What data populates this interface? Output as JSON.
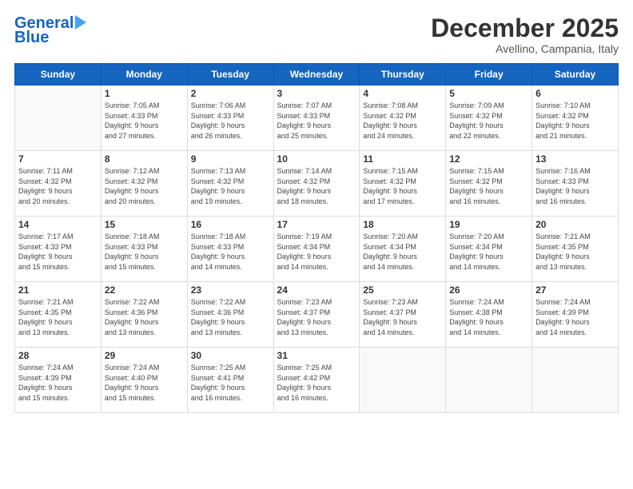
{
  "header": {
    "logo_line1": "General",
    "logo_line2": "Blue",
    "title": "December 2025",
    "subtitle": "Avellino, Campania, Italy"
  },
  "weekdays": [
    "Sunday",
    "Monday",
    "Tuesday",
    "Wednesday",
    "Thursday",
    "Friday",
    "Saturday"
  ],
  "weeks": [
    [
      {
        "num": "",
        "info": ""
      },
      {
        "num": "1",
        "info": "Sunrise: 7:05 AM\nSunset: 4:33 PM\nDaylight: 9 hours\nand 27 minutes."
      },
      {
        "num": "2",
        "info": "Sunrise: 7:06 AM\nSunset: 4:33 PM\nDaylight: 9 hours\nand 26 minutes."
      },
      {
        "num": "3",
        "info": "Sunrise: 7:07 AM\nSunset: 4:33 PM\nDaylight: 9 hours\nand 25 minutes."
      },
      {
        "num": "4",
        "info": "Sunrise: 7:08 AM\nSunset: 4:32 PM\nDaylight: 9 hours\nand 24 minutes."
      },
      {
        "num": "5",
        "info": "Sunrise: 7:09 AM\nSunset: 4:32 PM\nDaylight: 9 hours\nand 22 minutes."
      },
      {
        "num": "6",
        "info": "Sunrise: 7:10 AM\nSunset: 4:32 PM\nDaylight: 9 hours\nand 21 minutes."
      }
    ],
    [
      {
        "num": "7",
        "info": "Sunrise: 7:11 AM\nSunset: 4:32 PM\nDaylight: 9 hours\nand 20 minutes."
      },
      {
        "num": "8",
        "info": "Sunrise: 7:12 AM\nSunset: 4:32 PM\nDaylight: 9 hours\nand 20 minutes."
      },
      {
        "num": "9",
        "info": "Sunrise: 7:13 AM\nSunset: 4:32 PM\nDaylight: 9 hours\nand 19 minutes."
      },
      {
        "num": "10",
        "info": "Sunrise: 7:14 AM\nSunset: 4:32 PM\nDaylight: 9 hours\nand 18 minutes."
      },
      {
        "num": "11",
        "info": "Sunrise: 7:15 AM\nSunset: 4:32 PM\nDaylight: 9 hours\nand 17 minutes."
      },
      {
        "num": "12",
        "info": "Sunrise: 7:15 AM\nSunset: 4:32 PM\nDaylight: 9 hours\nand 16 minutes."
      },
      {
        "num": "13",
        "info": "Sunrise: 7:16 AM\nSunset: 4:33 PM\nDaylight: 9 hours\nand 16 minutes."
      }
    ],
    [
      {
        "num": "14",
        "info": "Sunrise: 7:17 AM\nSunset: 4:33 PM\nDaylight: 9 hours\nand 15 minutes."
      },
      {
        "num": "15",
        "info": "Sunrise: 7:18 AM\nSunset: 4:33 PM\nDaylight: 9 hours\nand 15 minutes."
      },
      {
        "num": "16",
        "info": "Sunrise: 7:18 AM\nSunset: 4:33 PM\nDaylight: 9 hours\nand 14 minutes."
      },
      {
        "num": "17",
        "info": "Sunrise: 7:19 AM\nSunset: 4:34 PM\nDaylight: 9 hours\nand 14 minutes."
      },
      {
        "num": "18",
        "info": "Sunrise: 7:20 AM\nSunset: 4:34 PM\nDaylight: 9 hours\nand 14 minutes."
      },
      {
        "num": "19",
        "info": "Sunrise: 7:20 AM\nSunset: 4:34 PM\nDaylight: 9 hours\nand 14 minutes."
      },
      {
        "num": "20",
        "info": "Sunrise: 7:21 AM\nSunset: 4:35 PM\nDaylight: 9 hours\nand 13 minutes."
      }
    ],
    [
      {
        "num": "21",
        "info": "Sunrise: 7:21 AM\nSunset: 4:35 PM\nDaylight: 9 hours\nand 13 minutes."
      },
      {
        "num": "22",
        "info": "Sunrise: 7:22 AM\nSunset: 4:36 PM\nDaylight: 9 hours\nand 13 minutes."
      },
      {
        "num": "23",
        "info": "Sunrise: 7:22 AM\nSunset: 4:36 PM\nDaylight: 9 hours\nand 13 minutes."
      },
      {
        "num": "24",
        "info": "Sunrise: 7:23 AM\nSunset: 4:37 PM\nDaylight: 9 hours\nand 13 minutes."
      },
      {
        "num": "25",
        "info": "Sunrise: 7:23 AM\nSunset: 4:37 PM\nDaylight: 9 hours\nand 14 minutes."
      },
      {
        "num": "26",
        "info": "Sunrise: 7:24 AM\nSunset: 4:38 PM\nDaylight: 9 hours\nand 14 minutes."
      },
      {
        "num": "27",
        "info": "Sunrise: 7:24 AM\nSunset: 4:39 PM\nDaylight: 9 hours\nand 14 minutes."
      }
    ],
    [
      {
        "num": "28",
        "info": "Sunrise: 7:24 AM\nSunset: 4:39 PM\nDaylight: 9 hours\nand 15 minutes."
      },
      {
        "num": "29",
        "info": "Sunrise: 7:24 AM\nSunset: 4:40 PM\nDaylight: 9 hours\nand 15 minutes."
      },
      {
        "num": "30",
        "info": "Sunrise: 7:25 AM\nSunset: 4:41 PM\nDaylight: 9 hours\nand 16 minutes."
      },
      {
        "num": "31",
        "info": "Sunrise: 7:25 AM\nSunset: 4:42 PM\nDaylight: 9 hours\nand 16 minutes."
      },
      {
        "num": "",
        "info": ""
      },
      {
        "num": "",
        "info": ""
      },
      {
        "num": "",
        "info": ""
      }
    ]
  ]
}
